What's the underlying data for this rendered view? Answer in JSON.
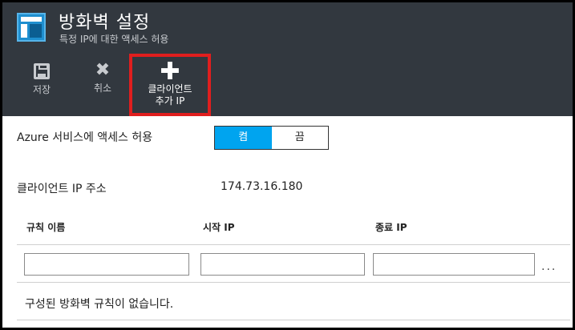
{
  "header": {
    "title": "방화벽 설정",
    "subtitle": "특정 IP에 대한 액세스 허용"
  },
  "toolbar": {
    "save_label": "저장",
    "cancel_label": "취소",
    "add_client_label_line1": "클라이언트",
    "add_client_label_line2": "추가 IP"
  },
  "azure_access": {
    "label": "Azure 서비스에 액세스 허용",
    "on_label": "켬",
    "off_label": "끔",
    "selected": "켬"
  },
  "client_ip": {
    "label": "클라이언트 IP 주소",
    "value": "174.73.16.180"
  },
  "rules_table": {
    "columns": [
      "규칙 이름",
      "시작 IP",
      "종료 IP"
    ],
    "new_row": {
      "name": "",
      "start_ip": "",
      "end_ip": ""
    },
    "more_glyph": "...",
    "empty_message": "구성된 방화벽 규칙이 없습니다."
  },
  "colors": {
    "header_bg": "#32383f",
    "accent": "#00a4ef",
    "highlight_border": "#e01e1e"
  },
  "icons": {
    "app": "firewall-blade-icon",
    "save": "save-icon",
    "cancel": "close-icon",
    "add": "plus-icon"
  }
}
